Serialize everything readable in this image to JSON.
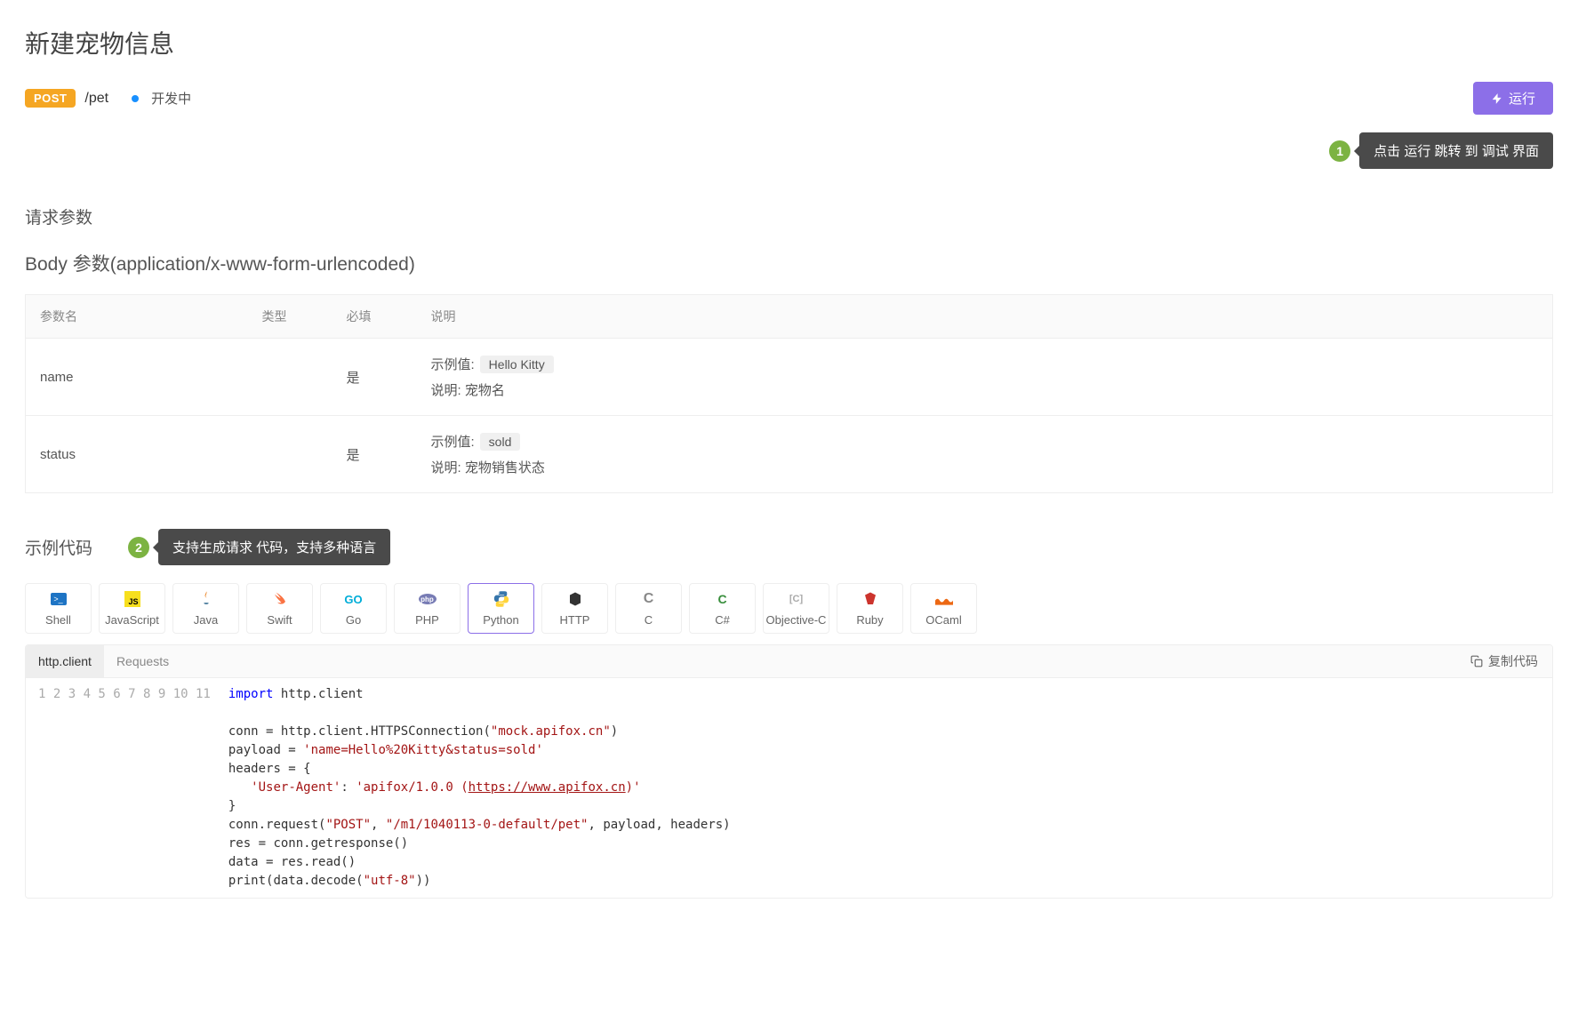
{
  "title": "新建宠物信息",
  "method": "POST",
  "path": "/pet",
  "devStatus": "开发中",
  "runButton": "运行",
  "annotations": {
    "a1": {
      "num": "1",
      "text": "点击 运行 跳转 到 调试 界面"
    },
    "a2": {
      "num": "2",
      "text": "支持生成请求 代码，支持多种语言"
    }
  },
  "sections": {
    "requestParams": "请求参数",
    "bodyParams": "Body 参数(application/x-www-form-urlencoded)",
    "sampleCode": "示例代码"
  },
  "paramTable": {
    "headers": {
      "name": "参数名",
      "type": "类型",
      "required": "必填",
      "description": "说明"
    },
    "exampleLabel": "示例值:",
    "descLabel": "说明:",
    "rows": [
      {
        "name": "name",
        "type": "",
        "required": "是",
        "example": "Hello Kitty",
        "desc": "宠物名"
      },
      {
        "name": "status",
        "type": "",
        "required": "是",
        "example": "sold",
        "desc": "宠物销售状态"
      }
    ]
  },
  "langTabs": [
    "Shell",
    "JavaScript",
    "Java",
    "Swift",
    "Go",
    "PHP",
    "Python",
    "HTTP",
    "C",
    "C#",
    "Objective-C",
    "Ruby",
    "OCaml"
  ],
  "activeLang": "Python",
  "subTabs": [
    "http.client",
    "Requests"
  ],
  "activeSubTab": "http.client",
  "copyLabel": "复制代码",
  "code": {
    "lines": [
      [
        {
          "t": "import",
          "c": "kw"
        },
        {
          "t": " http.client",
          "c": ""
        }
      ],
      [
        {
          "t": "",
          "c": ""
        }
      ],
      [
        {
          "t": "conn = http.client.HTTPSConnection(",
          "c": ""
        },
        {
          "t": "\"mock.apifox.cn\"",
          "c": "str"
        },
        {
          "t": ")",
          "c": ""
        }
      ],
      [
        {
          "t": "payload = ",
          "c": ""
        },
        {
          "t": "'name=Hello%20Kitty&status=sold'",
          "c": "str"
        }
      ],
      [
        {
          "t": "headers = {",
          "c": ""
        }
      ],
      [
        {
          "t": "   ",
          "c": ""
        },
        {
          "t": "'User-Agent'",
          "c": "str"
        },
        {
          "t": ": ",
          "c": ""
        },
        {
          "t": "'apifox/1.0.0 (",
          "c": "str"
        },
        {
          "t": "https://www.apifox.cn",
          "c": "str url"
        },
        {
          "t": ")'",
          "c": "str"
        }
      ],
      [
        {
          "t": "}",
          "c": ""
        }
      ],
      [
        {
          "t": "conn.request(",
          "c": ""
        },
        {
          "t": "\"POST\"",
          "c": "str"
        },
        {
          "t": ", ",
          "c": ""
        },
        {
          "t": "\"/m1/1040113-0-default/pet\"",
          "c": "str"
        },
        {
          "t": ", payload, headers)",
          "c": ""
        }
      ],
      [
        {
          "t": "res = conn.getresponse()",
          "c": ""
        }
      ],
      [
        {
          "t": "data = res.read()",
          "c": ""
        }
      ],
      [
        {
          "t": "print(data.decode(",
          "c": ""
        },
        {
          "t": "\"utf-8\"",
          "c": "str"
        },
        {
          "t": "))",
          "c": ""
        }
      ]
    ]
  },
  "langIcons": {
    "Shell": "#1e74c4",
    "JavaScript": "#f7df1e",
    "Java": "#5382a1",
    "Swift": "#fa7343",
    "Go": "#00add8",
    "PHP": "#777bb4",
    "Python": "python",
    "HTTP": "#333",
    "C": "#888",
    "C#": "#388e3c",
    "Objective-C": "#888",
    "Ruby": "#cc342d",
    "OCaml": "#ec6813"
  }
}
